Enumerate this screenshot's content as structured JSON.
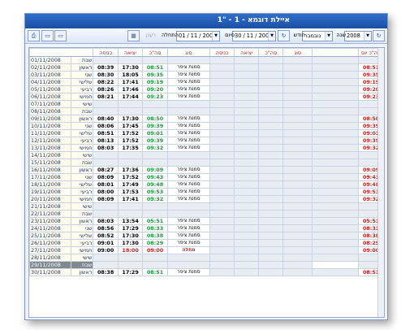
{
  "window": {
    "title": "איילת  דוגמא - 1 - \"1"
  },
  "toolbar": {
    "year_label": "שנה",
    "year_value": "2008",
    "month_label": "חודש",
    "month_value": "נובמבר",
    "end_label": "סיום",
    "end_value": "30 / 11 / 2008",
    "start_label": "התחלה",
    "start_value": "01 / 11 / 2008",
    "disabled_label": "רענן",
    "icons": [
      "refresh-icon",
      "refresh-icon",
      "save-icon",
      "monitor-icon",
      "monitor-icon",
      "print-icon"
    ]
  },
  "grid": {
    "headers": [
      "סה\"כ יום",
      "סוג",
      "סה\"כ",
      "יציאה",
      "כניסה",
      "סוג",
      "סה\"כ",
      "יציאה",
      "כניסה"
    ],
    "rows": [
      {
        "date": "01/11/2008",
        "day": "שבת",
        "in": "",
        "out": "",
        "total": "",
        "type": "",
        "daytotal": "",
        "kind": "empty"
      },
      {
        "date": "02/11/2008",
        "day": "ראשון",
        "in": "08:39",
        "out": "17:30",
        "total": "08:51",
        "type": "סמנת ציפר",
        "daytotal": "08:51",
        "kind": "red"
      },
      {
        "date": "03/11/2008",
        "day": "שני",
        "in": "08:30",
        "out": "18:05",
        "total": "09:35",
        "type": "סמנת ציפר",
        "daytotal": "09:35",
        "kind": "red"
      },
      {
        "date": "04/11/2008",
        "day": "שלישי",
        "in": "08:22",
        "out": "17:41",
        "total": "09:19",
        "type": "סמנת ציפר",
        "daytotal": "09:19",
        "kind": "red"
      },
      {
        "date": "05/11/2008",
        "day": "רביעי",
        "in": "08:26",
        "out": "17:46",
        "total": "09:20",
        "type": "סמנת ציפר",
        "daytotal": "09:20",
        "kind": "red"
      },
      {
        "date": "06/11/2008",
        "day": "חמישי",
        "in": "08:21",
        "out": "17:44",
        "total": "09:23",
        "type": "סמנת ציפר",
        "daytotal": "09:23",
        "kind": "red"
      },
      {
        "date": "07/11/2008",
        "day": "שישי",
        "in": "",
        "out": "",
        "total": "",
        "type": "",
        "daytotal": "",
        "kind": "empty"
      },
      {
        "date": "08/11/2008",
        "day": "שבת",
        "in": "",
        "out": "",
        "total": "",
        "type": "",
        "daytotal": "",
        "kind": "empty"
      },
      {
        "date": "09/11/2008",
        "day": "ראשון",
        "in": "08:40",
        "out": "17:30",
        "total": "08:50",
        "type": "סמנת ציפר",
        "daytotal": "08:50",
        "kind": "red"
      },
      {
        "date": "10/11/2008",
        "day": "שני",
        "in": "08:06",
        "out": "17:45",
        "total": "09:39",
        "type": "סמנת ציפר",
        "daytotal": "09:39",
        "kind": "red"
      },
      {
        "date": "11/11/2008",
        "day": "שלישי",
        "in": "08:51",
        "out": "17:52",
        "total": "09:01",
        "type": "סמנת ציפר",
        "daytotal": "09:01",
        "kind": "red"
      },
      {
        "date": "12/11/2008",
        "day": "רביעי",
        "in": "08:13",
        "out": "17:52",
        "total": "09:39",
        "type": "סמנת ציפר",
        "daytotal": "09:39",
        "kind": "red"
      },
      {
        "date": "13/11/2008",
        "day": "חמישי",
        "in": "08:03",
        "out": "17:35",
        "total": "09:32",
        "type": "סמנת ציפר",
        "daytotal": "09:32",
        "kind": "red"
      },
      {
        "date": "14/11/2008",
        "day": "שישי",
        "in": "",
        "out": "",
        "total": "",
        "type": "",
        "daytotal": "",
        "kind": "empty"
      },
      {
        "date": "15/11/2008",
        "day": "שבת",
        "in": "",
        "out": "",
        "total": "",
        "type": "",
        "daytotal": "",
        "kind": "empty"
      },
      {
        "date": "16/11/2008",
        "day": "ראשון",
        "in": "08:27",
        "out": "17:36",
        "total": "09:09",
        "type": "סמנת ציפר",
        "daytotal": "09:09",
        "kind": "red"
      },
      {
        "date": "17/11/2008",
        "day": "שני",
        "in": "08:09",
        "out": "17:52",
        "total": "09:43",
        "type": "סמנת ציפר",
        "daytotal": "09:43",
        "kind": "red"
      },
      {
        "date": "18/11/2008",
        "day": "שלישי",
        "in": "08:01",
        "out": "17:49",
        "total": "09:48",
        "type": "סמנת ציפר",
        "daytotal": "09:48",
        "kind": "red"
      },
      {
        "date": "19/11/2008",
        "day": "רביעי",
        "in": "08:00",
        "out": "17:53",
        "total": "09:53",
        "type": "סמנת ציפר",
        "daytotal": "09:53",
        "kind": "red"
      },
      {
        "date": "20/11/2008",
        "day": "חמישי",
        "in": "08:09",
        "out": "17:41",
        "total": "09:32",
        "type": "סמנת ציפר",
        "daytotal": "09:32",
        "kind": "red"
      },
      {
        "date": "21/11/2008",
        "day": "שישי",
        "in": "",
        "out": "",
        "total": "",
        "type": "",
        "daytotal": "",
        "kind": "empty"
      },
      {
        "date": "22/11/2008",
        "day": "שבת",
        "in": "",
        "out": "",
        "total": "",
        "type": "",
        "daytotal": "",
        "kind": "empty"
      },
      {
        "date": "23/11/2008",
        "day": "ראשון",
        "in": "08:03",
        "out": "13:54",
        "total": "05:51",
        "type": "סמנת ציפר",
        "daytotal": "05:51",
        "kind": "red"
      },
      {
        "date": "24/11/2008",
        "day": "שני",
        "in": "08:56",
        "out": "17:29",
        "total": "08:33",
        "type": "סמנת ציפר",
        "daytotal": "08:33",
        "kind": "red"
      },
      {
        "date": "25/11/2008",
        "day": "שלישי",
        "in": "08:52",
        "out": "17:30",
        "total": "08:38",
        "type": "סמנת ציפר",
        "daytotal": "08:38",
        "kind": "red"
      },
      {
        "date": "26/11/2008",
        "day": "רביעי",
        "in": "09:01",
        "out": "17:30",
        "total": "08:29",
        "type": "סמנת ציפר",
        "daytotal": "08:29",
        "kind": "red"
      },
      {
        "date": "27/11/2008",
        "day": "חמישי",
        "in": "09:00",
        "out": "18:00",
        "total": "09:00",
        "type": "מחלה",
        "daytotal": "09:00",
        "kind": "sick"
      },
      {
        "date": "28/11/2008",
        "day": "שישי",
        "in": "",
        "out": "",
        "total": "",
        "type": "",
        "daytotal": "",
        "kind": "empty"
      },
      {
        "date": "29/11/2008",
        "day": "שבת",
        "in": "",
        "out": "",
        "total": "",
        "type": "",
        "daytotal": "",
        "kind": "selected"
      },
      {
        "date": "30/11/2008",
        "day": "ראשון",
        "in": "08:38",
        "out": "17:29",
        "total": "08:51",
        "type": "סמנת ציפר",
        "daytotal": "08:51",
        "kind": "red"
      }
    ]
  }
}
